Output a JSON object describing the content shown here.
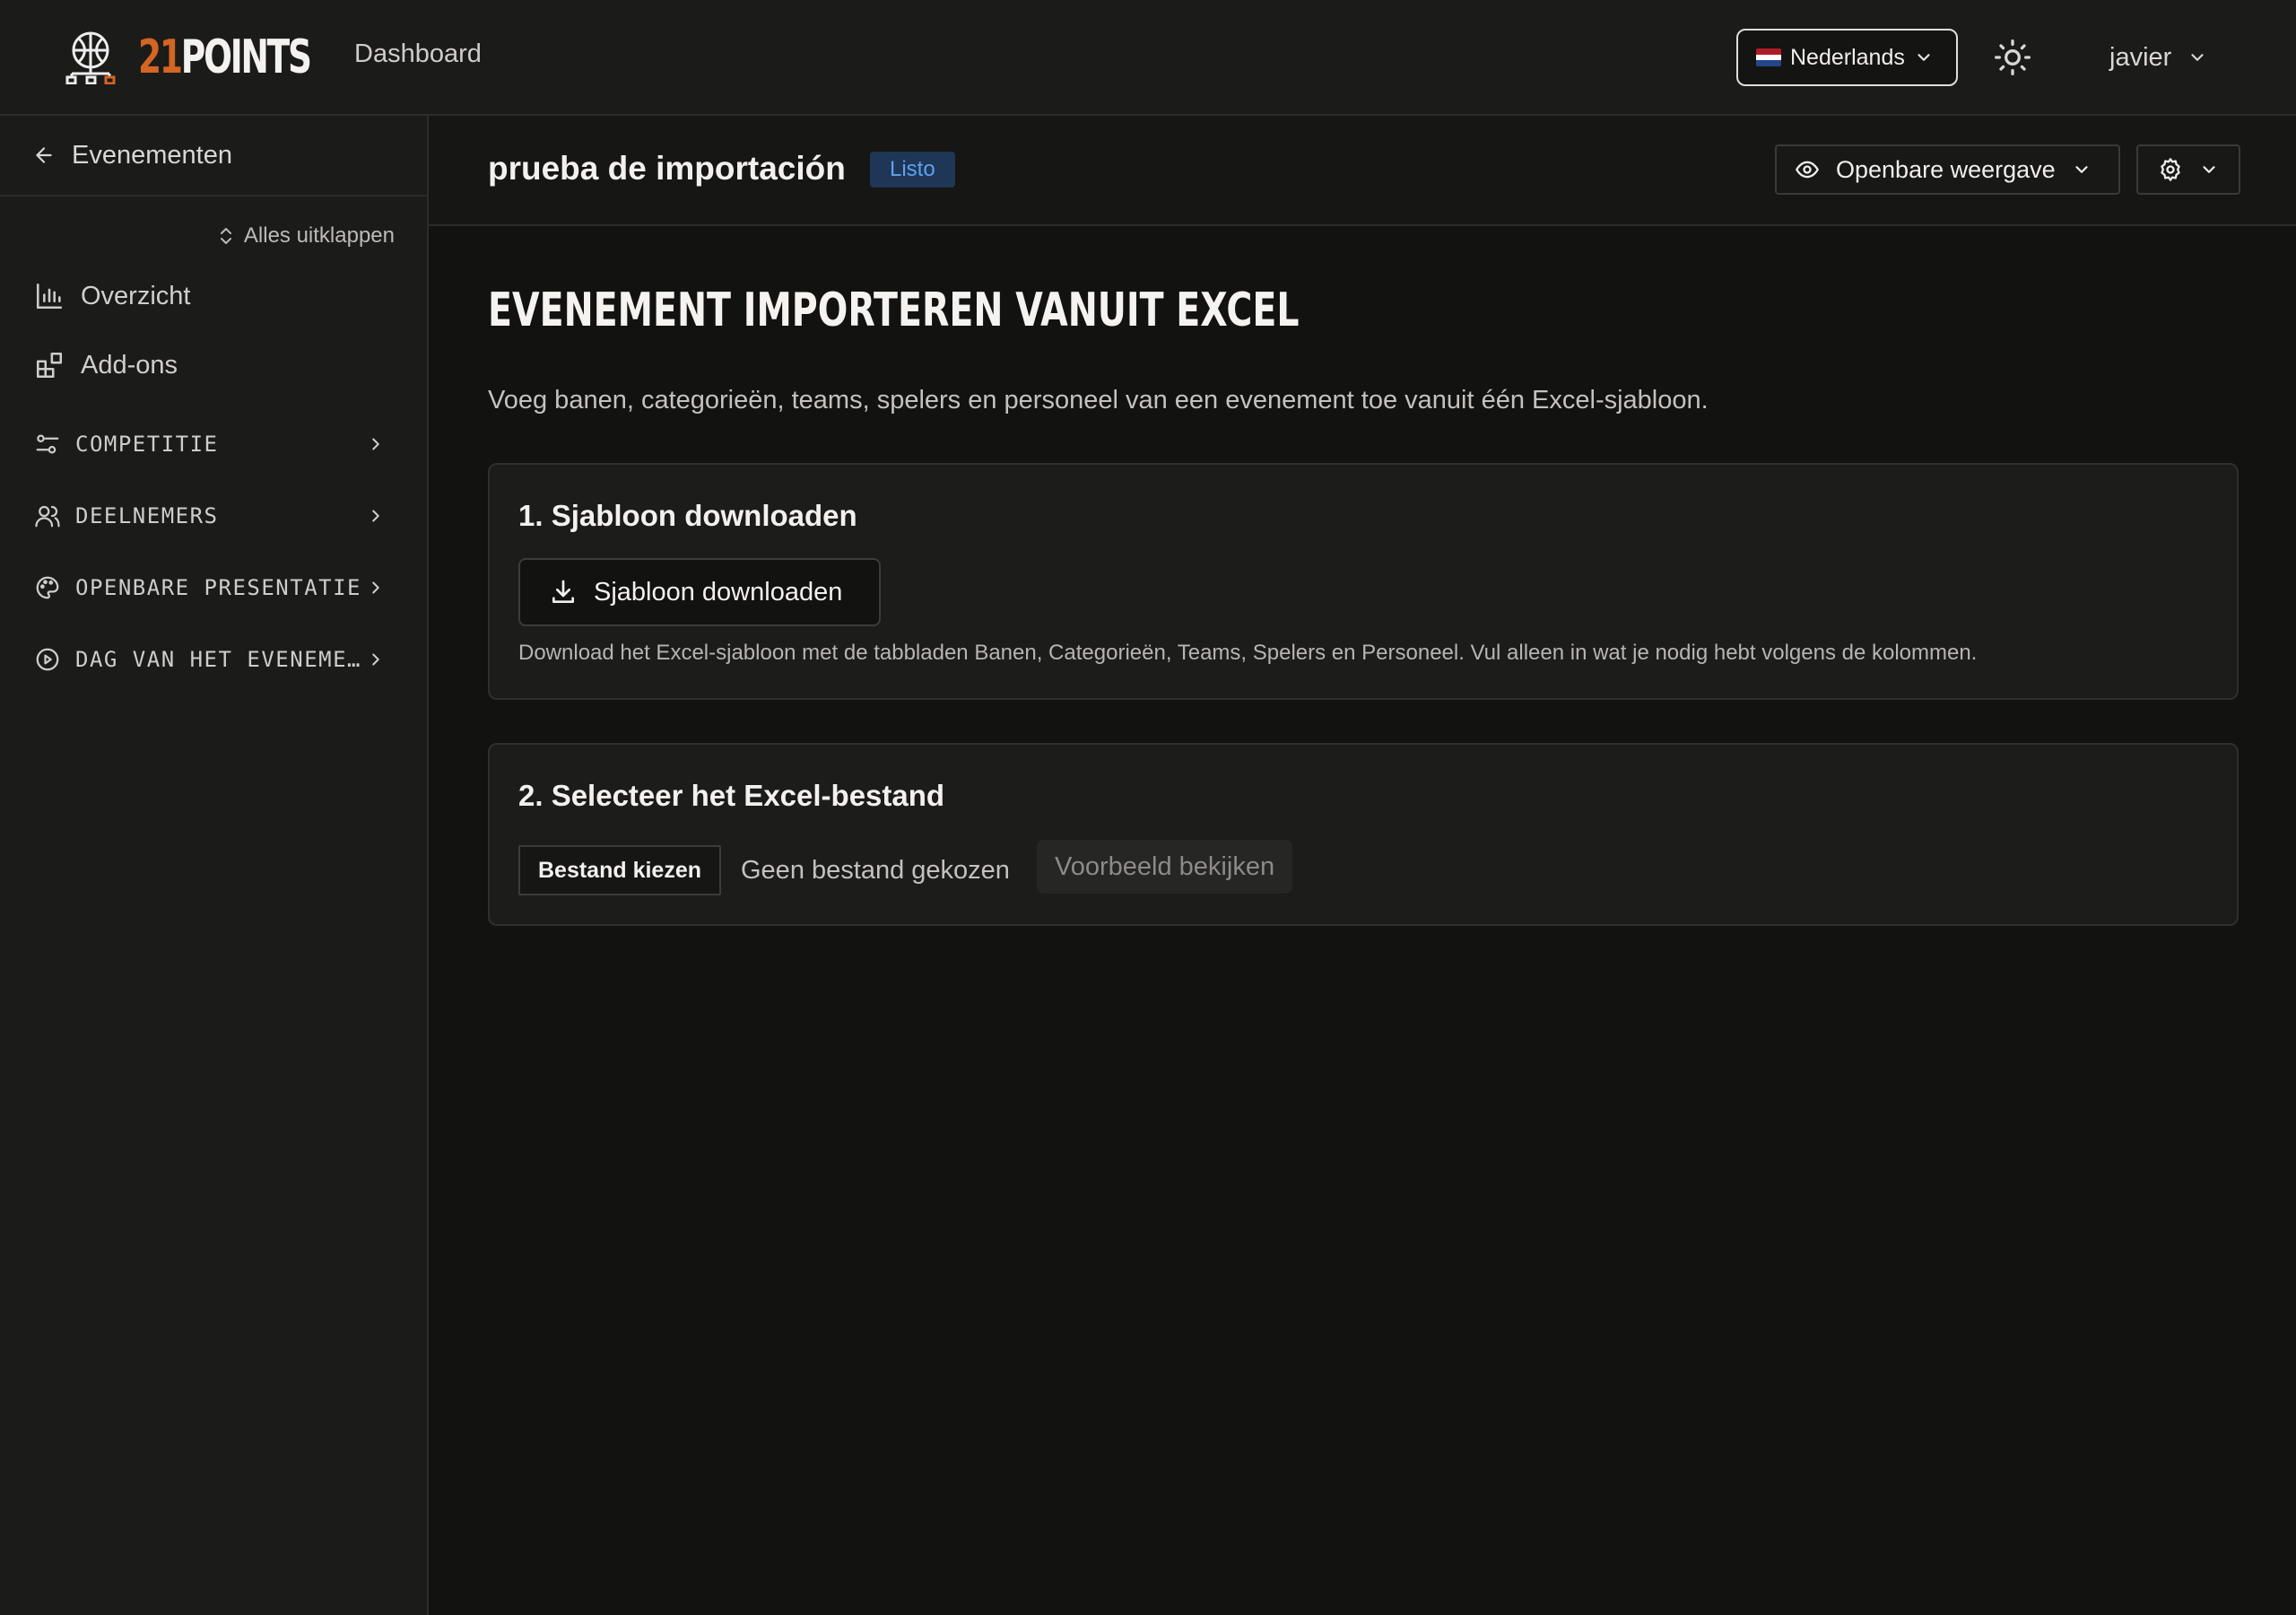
{
  "header": {
    "logo": {
      "number": "21",
      "word": "POINTS"
    },
    "nav_dashboard": "Dashboard",
    "language": "Nederlands",
    "user": "javier"
  },
  "sidebar": {
    "back_label": "Evenementen",
    "expand_all": "Alles uitklappen",
    "items": [
      {
        "label": "Overzicht",
        "icon": "bar-chart-icon"
      },
      {
        "label": "Add-ons",
        "icon": "add-ons-icon"
      }
    ],
    "groups": [
      {
        "label": "COMPETITIE",
        "icon": "sliders-icon"
      },
      {
        "label": "DEELNEMERS",
        "icon": "users-icon"
      },
      {
        "label": "OPENBARE PRESENTATIE",
        "icon": "palette-icon"
      },
      {
        "label": "DAG VAN HET EVENEME…",
        "icon": "play-circle-icon"
      }
    ]
  },
  "page": {
    "title": "prueba de importación",
    "status": "Listo",
    "public_view": "Openbare weergave"
  },
  "main": {
    "heading": "EVENEMENT IMPORTEREN VANUIT EXCEL",
    "description": "Voeg banen, categorieën, teams, spelers en personeel van een evenement toe vanuit één Excel-sjabloon.",
    "step1": {
      "title": "1. Sjabloon downloaden",
      "button": "Sjabloon downloaden",
      "note": "Download het Excel-sjabloon met de tabbladen Banen, Categorieën, Teams, Spelers en Personeel. Vul alleen in wat je nodig hebt volgens de kolommen."
    },
    "step2": {
      "title": "2. Selecteer het Excel-bestand",
      "choose_button": "Bestand kiezen",
      "file_status": "Geen bestand gekozen",
      "preview_button": "Voorbeeld bekijken"
    }
  },
  "colors": {
    "background": "#121210",
    "surface": "#1b1b1a",
    "accent_orange": "#d46522",
    "badge_bg": "#1f3656",
    "badge_text": "#5ea2ee"
  }
}
